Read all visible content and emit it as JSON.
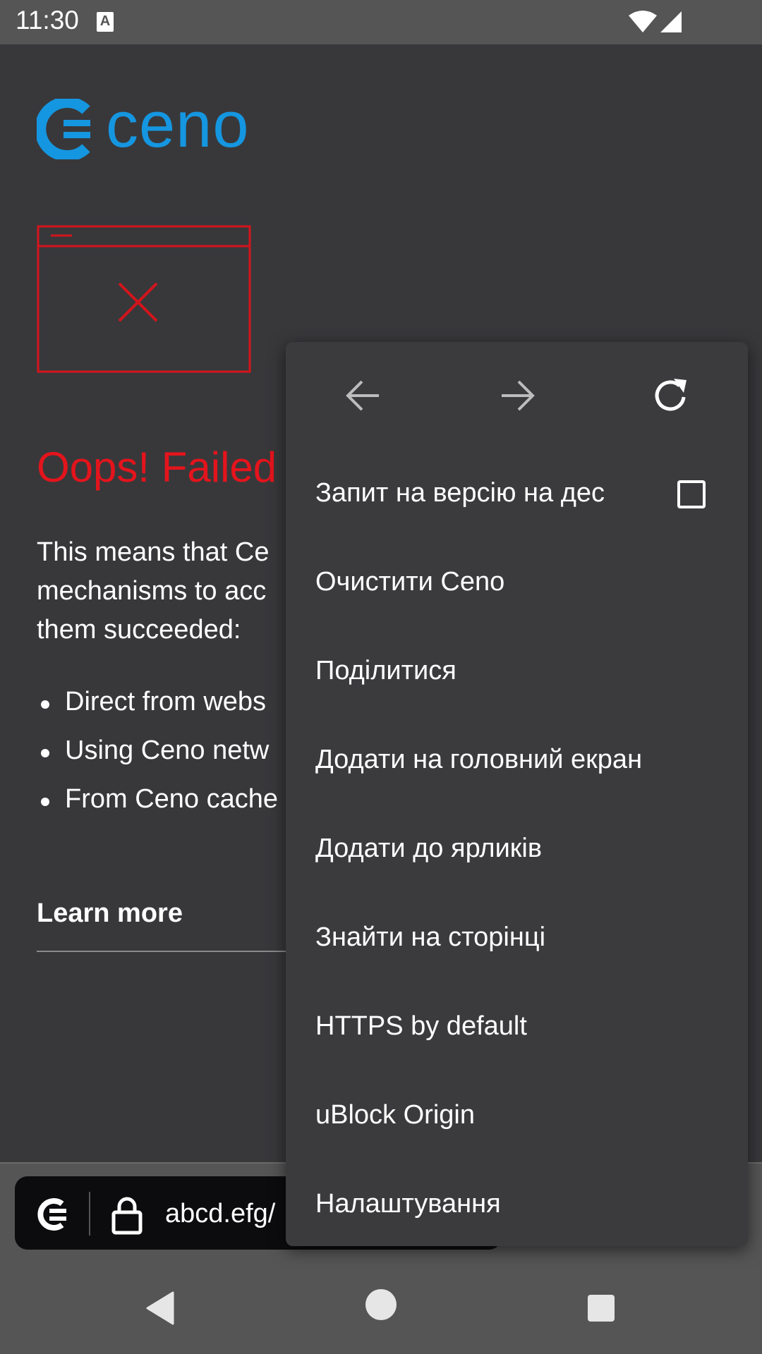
{
  "status_bar": {
    "time": "11:30",
    "notification_icon": "a-icon",
    "icons": [
      "wifi-icon",
      "signal-icon"
    ]
  },
  "page": {
    "logo_text": "ceno",
    "error_title": "Oops! Failed",
    "description_lines": [
      "This means that Ce",
      "mechanisms to acc",
      "them succeeded:"
    ],
    "bullets": [
      "Direct from webs",
      "Using Ceno netw",
      "From Ceno cache"
    ],
    "learn_more": "Learn more"
  },
  "url_bar": {
    "url": "abcd.efg/",
    "icons": [
      "ceno-icon",
      "lock-icon"
    ]
  },
  "menu": {
    "nav_icons": [
      "back-arrow-icon",
      "forward-arrow-icon",
      "reload-icon"
    ],
    "items": [
      {
        "label": "Запит на версію на дес",
        "has_checkbox": true,
        "checked": false
      },
      {
        "label": "Очистити Ceno"
      },
      {
        "label": "Поділитися"
      },
      {
        "label": "Додати на головний екран"
      },
      {
        "label": "Додати до ярликів"
      },
      {
        "label": "Знайти на сторінці"
      },
      {
        "label": "HTTPS by default"
      },
      {
        "label": "uBlock Origin"
      },
      {
        "label": "Налаштування"
      }
    ]
  },
  "system_nav": {
    "icons": [
      "back-triangle-icon",
      "home-circle-icon",
      "recents-square-icon"
    ]
  },
  "colors": {
    "brand_blue": "#1596e0",
    "error_red": "#e4141c",
    "background": "#38383b",
    "menu_background": "#3b3b3e"
  }
}
